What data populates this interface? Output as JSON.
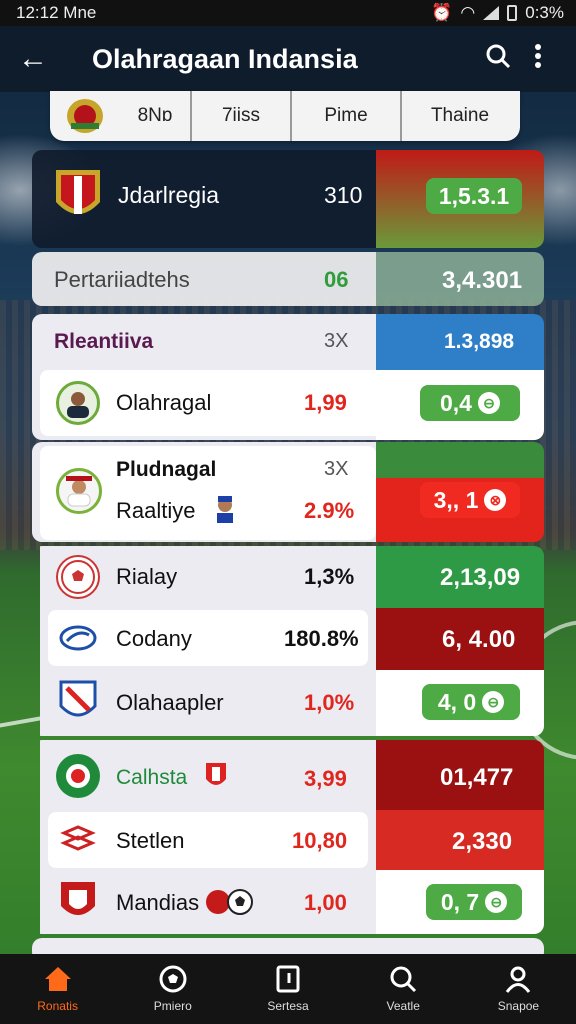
{
  "status_bar": {
    "time": "12:12",
    "carrier": "Mne",
    "battery": "0:3%"
  },
  "app_bar": {
    "title": "Olahragaan Indansia",
    "back_icon": "arrow-left-icon",
    "search_icon": "search-icon",
    "menu_icon": "more-vert-icon"
  },
  "tabs": [
    {
      "label": "8Nɒ"
    },
    {
      "label": "7iiss"
    },
    {
      "label": "Pime"
    },
    {
      "label": "Thaine"
    }
  ],
  "featured": {
    "name": "Jdarlregia",
    "score": "310",
    "odds": "1,5.3.1"
  },
  "summary": {
    "label": "Pertariiadtehs",
    "value": "06",
    "odds": "3,4.301"
  },
  "group1": {
    "header": "Rleantiiva",
    "header_mark": "3X",
    "header_odds": "1.3,898",
    "rows": [
      {
        "name": "Olahragal",
        "value": "1,99",
        "odds": "0,4"
      }
    ]
  },
  "group2": {
    "title": "Pludnagal",
    "header_mark": "3X",
    "rows": [
      {
        "name": "Raaltiye",
        "value": "2.9%",
        "odds": "3,, 1"
      }
    ]
  },
  "group3": {
    "rows": [
      {
        "name": "Rialay",
        "value": "1,3%",
        "odds": "2,13,09"
      },
      {
        "name": "Codany",
        "value": "180.8%",
        "odds": "6, 4.00"
      },
      {
        "name": "Olahaapler",
        "value": "1,0%",
        "odds": "4, 0"
      }
    ]
  },
  "group4": {
    "rows": [
      {
        "name": "Calhsta",
        "value": "3,99",
        "odds": "01,477"
      },
      {
        "name": "Stetlen",
        "value": "10,80",
        "odds": "2,330"
      },
      {
        "name": "Mandias",
        "value": "1,00",
        "odds": "0, 7"
      }
    ]
  },
  "nav": [
    {
      "label": "Ronatis",
      "icon": "home-icon"
    },
    {
      "label": "Pmiero",
      "icon": "soccer-ball-icon"
    },
    {
      "label": "Sertesa",
      "icon": "document-icon"
    },
    {
      "label": "Veatle",
      "icon": "search-icon"
    },
    {
      "label": "Snapoe",
      "icon": "profile-icon"
    }
  ],
  "colors": {
    "accent_green": "#4eaa44",
    "accent_red": "#e0261d",
    "dark_red": "#9b1111",
    "blue": "#2f7fc8",
    "nav_active": "#ff6a1a"
  }
}
